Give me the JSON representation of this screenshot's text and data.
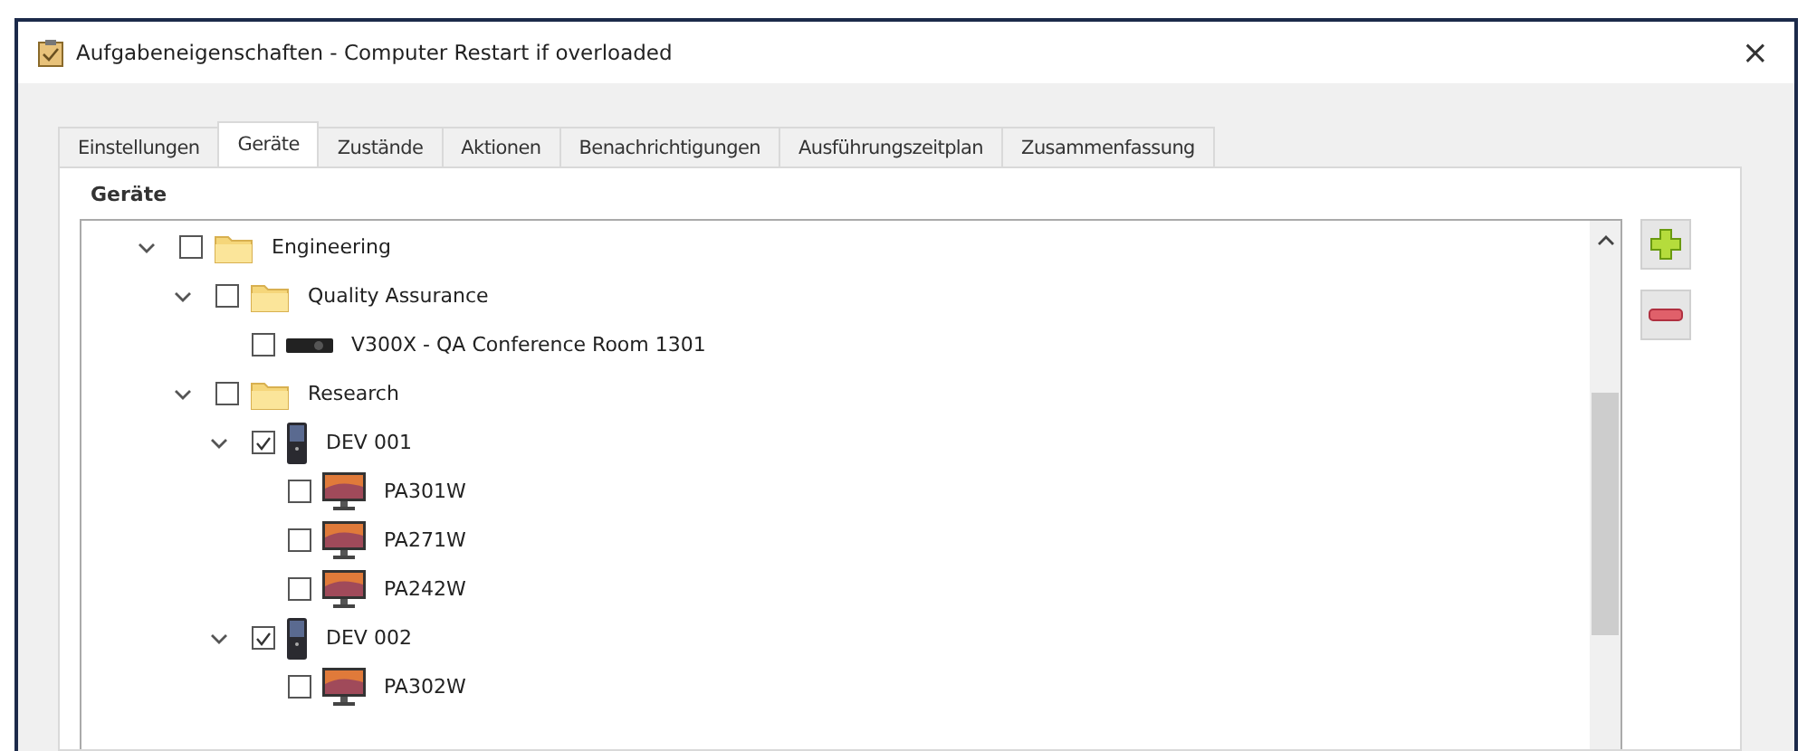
{
  "window": {
    "title": "Aufgabeneigenschaften - Computer Restart if overloaded",
    "close": "×"
  },
  "tabs": [
    {
      "label": "Einstellungen",
      "selected": false
    },
    {
      "label": "Geräte",
      "selected": true
    },
    {
      "label": "Zustände",
      "selected": false
    },
    {
      "label": "Aktionen",
      "selected": false
    },
    {
      "label": "Benachrichtigungen",
      "selected": false
    },
    {
      "label": "Ausführungszeitplan",
      "selected": false
    },
    {
      "label": "Zusammenfassung",
      "selected": false
    }
  ],
  "group": {
    "title": "Geräte"
  },
  "tree": [
    {
      "label": "Engineering",
      "kind": "folder",
      "checked": false,
      "expanded": true,
      "children": [
        {
          "label": "Quality Assurance",
          "kind": "folder",
          "checked": false,
          "expanded": true,
          "children": [
            {
              "label": "V300X - QA Conference Room 1301",
              "kind": "projector",
              "checked": false
            }
          ]
        },
        {
          "label": "Research",
          "kind": "folder",
          "checked": false,
          "expanded": true,
          "children": [
            {
              "label": "DEV 001",
              "kind": "computer",
              "checked": true,
              "expanded": true,
              "children": [
                {
                  "label": "PA301W",
                  "kind": "monitor",
                  "checked": false
                },
                {
                  "label": "PA271W",
                  "kind": "monitor",
                  "checked": false
                },
                {
                  "label": "PA242W",
                  "kind": "monitor",
                  "checked": false
                }
              ]
            },
            {
              "label": "DEV 002",
              "kind": "computer",
              "checked": true,
              "expanded": true,
              "children": [
                {
                  "label": "PA302W",
                  "kind": "monitor",
                  "checked": false
                }
              ]
            }
          ]
        }
      ]
    }
  ]
}
